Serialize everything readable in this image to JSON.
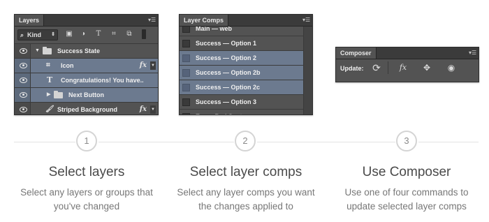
{
  "layers_panel": {
    "title": "Layers",
    "menu_icon": "panel-menu-icon",
    "filter_label": "Kind",
    "filter_icons": [
      "image-filter-icon",
      "adjustment-filter-icon",
      "type-filter-icon",
      "shape-filter-icon",
      "smart-object-filter-icon"
    ],
    "rows": [
      {
        "name": "Success State",
        "type": "group-open",
        "selected": false
      },
      {
        "name": "Icon",
        "type": "shape",
        "fx": "fx",
        "selected": true
      },
      {
        "name": "Congratulations! You have..",
        "type": "text",
        "selected": true
      },
      {
        "name": "Next Button",
        "type": "group-closed",
        "selected": true
      },
      {
        "name": "Striped Background",
        "type": "brush",
        "fx": "fx",
        "selected": false
      }
    ],
    "selection_color": "#6c7a8f"
  },
  "layer_comps_panel": {
    "title": "Layer Comps",
    "rows": [
      {
        "name": "Main — web",
        "selected": false
      },
      {
        "name": "Success — Option 1",
        "selected": false
      },
      {
        "name": "Success — Option 2",
        "selected": true
      },
      {
        "name": "Success — Option 2b",
        "selected": true
      },
      {
        "name": "Success — Option 2c",
        "selected": true
      },
      {
        "name": "Success — Option 3",
        "selected": false
      },
      {
        "name": "Error: Bad Syntax",
        "selected": false
      }
    ]
  },
  "composer_panel": {
    "title": "Composer",
    "update_label": "Update:",
    "commands": [
      "refresh-icon",
      "fx-icon",
      "move-icon",
      "visibility-icon"
    ]
  },
  "steps": [
    {
      "number": "1",
      "title": "Select layers",
      "desc_line1": "Select any layers or groups that",
      "desc_line2": "you've changed"
    },
    {
      "number": "2",
      "title": "Select layer comps",
      "desc_line1": "Select any layer comps you want",
      "desc_line2": "the changes applied to"
    },
    {
      "number": "3",
      "title": "Use Composer",
      "desc_line1": "Use one of four commands to",
      "desc_line2": "update selected layer comps"
    }
  ]
}
